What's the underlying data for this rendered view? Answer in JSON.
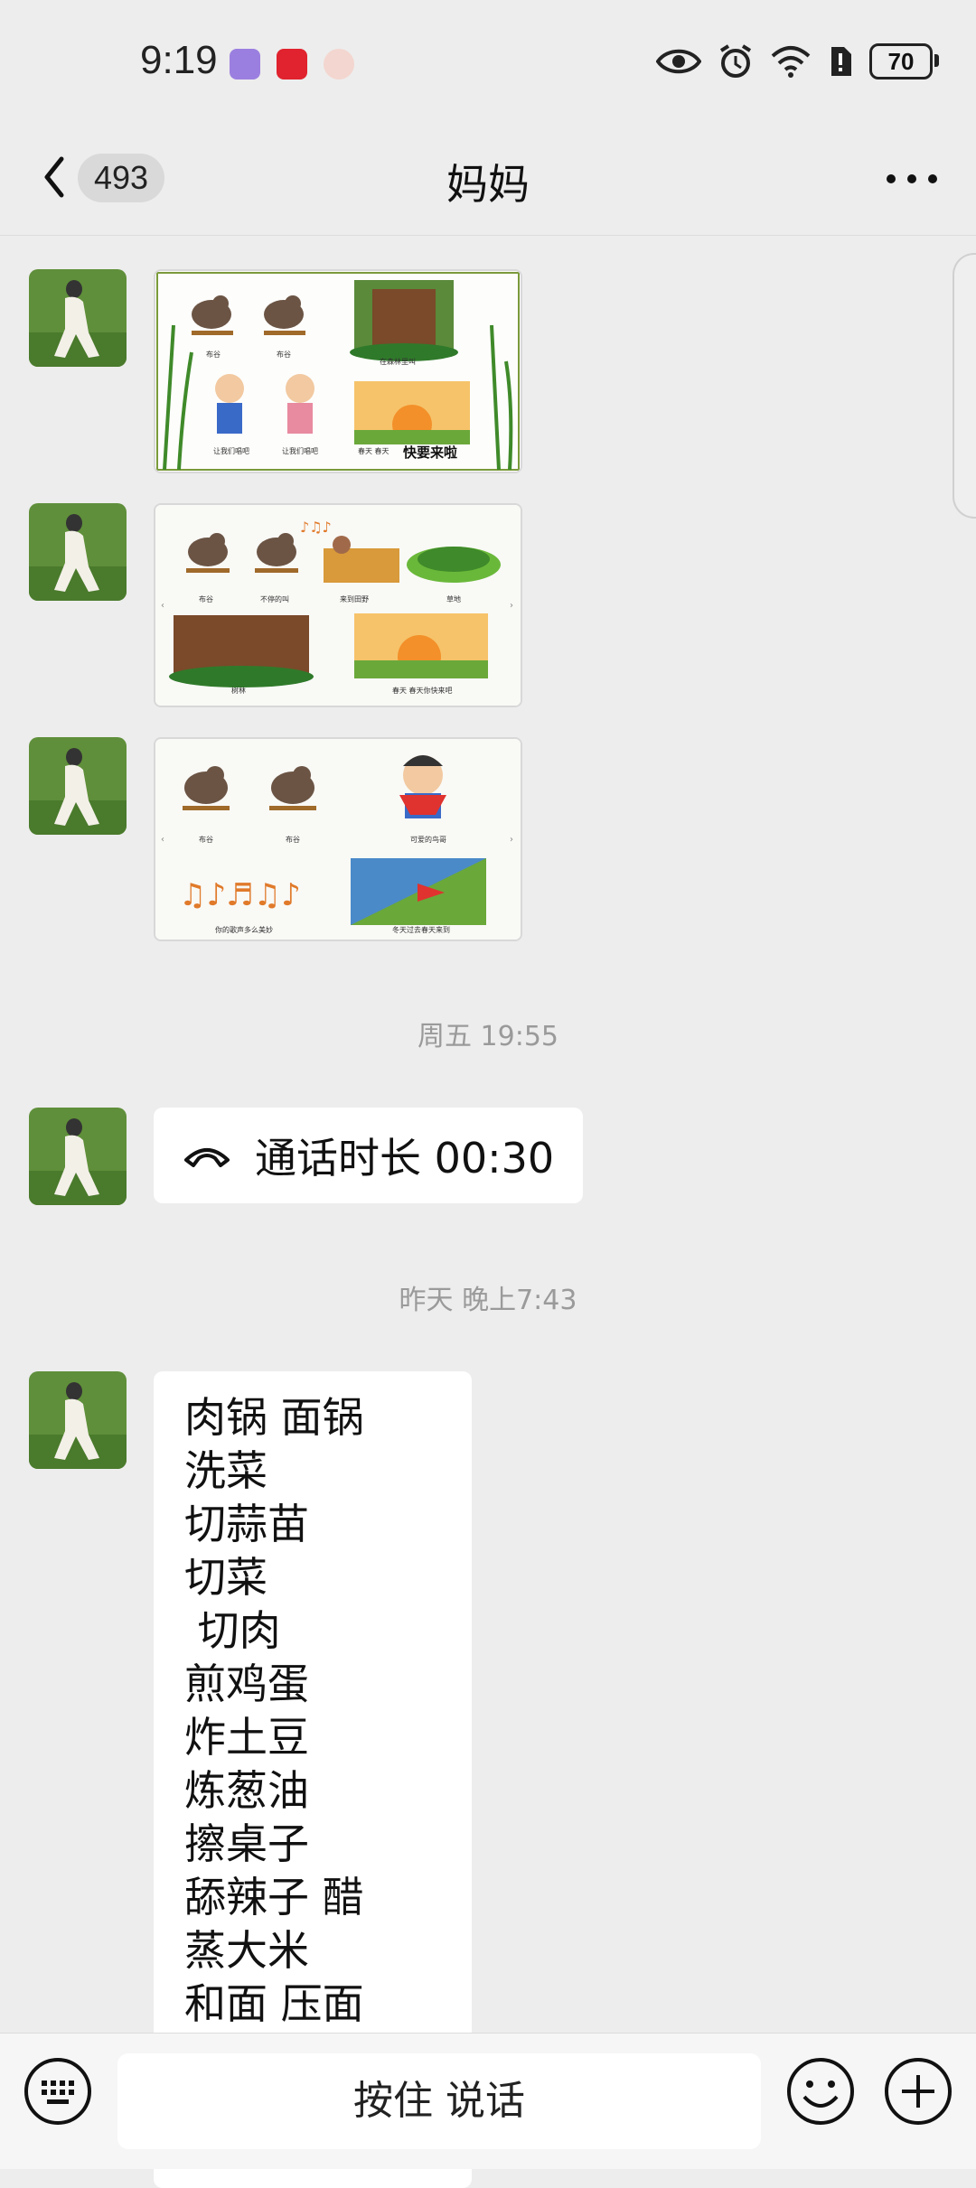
{
  "status_bar": {
    "time": "9:19",
    "battery": "70"
  },
  "header": {
    "back_count": "493",
    "title": "妈妈"
  },
  "image_messages": [
    {
      "captions": [
        "布谷",
        "布谷",
        "在森林里叫",
        "让我们唱吧",
        "让我们唱吧",
        "春天 春天",
        "快要来啦"
      ]
    },
    {
      "captions": [
        "布谷",
        "不停的叫",
        "来到田野",
        "草地",
        "树林",
        "春天 春天你快来吧"
      ]
    },
    {
      "captions": [
        "布谷",
        "布谷",
        "可爱的鸟哥",
        "你的歌声多么美妙",
        "冬天过去春天来到"
      ]
    }
  ],
  "time_separators": [
    "周五 19:55",
    "昨天 晚上7:43"
  ],
  "call_message": {
    "text": "通话时长 00:30"
  },
  "text_message": {
    "lines": [
      "肉锅 面锅",
      "洗菜",
      "切蒜苗",
      "切菜",
      " 切肉",
      "煎鸡蛋",
      "炸土豆",
      "炼葱油",
      "擦桌子",
      "舔辣子 醋",
      "蒸大米",
      "和面 压面"
    ]
  },
  "input_bar": {
    "hold_to_talk": "按住 说话"
  },
  "icons": [
    "back-arrow-icon",
    "more-icon",
    "phone-icon",
    "keyboard-icon",
    "emoji-icon",
    "plus-icon",
    "eye-icon",
    "alarm-icon",
    "wifi-icon"
  ]
}
